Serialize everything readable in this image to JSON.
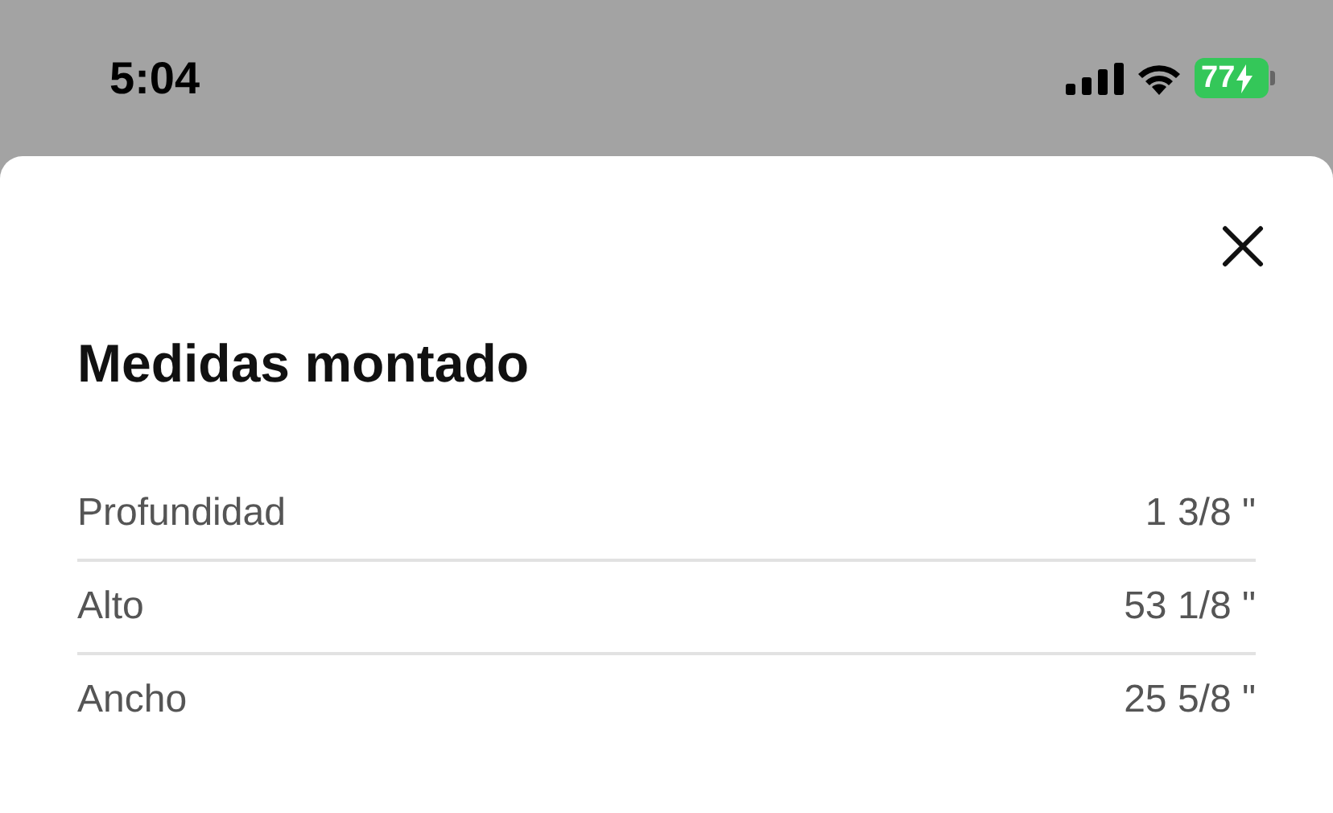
{
  "status_bar": {
    "time": "5:04",
    "battery": "77"
  },
  "sheet": {
    "title": "Medidas montado",
    "rows": [
      {
        "label": "Profundidad",
        "value": "1 3/8 \""
      },
      {
        "label": "Alto",
        "value": "53 1/8 \""
      },
      {
        "label": "Ancho",
        "value": "25 5/8 \""
      }
    ]
  }
}
